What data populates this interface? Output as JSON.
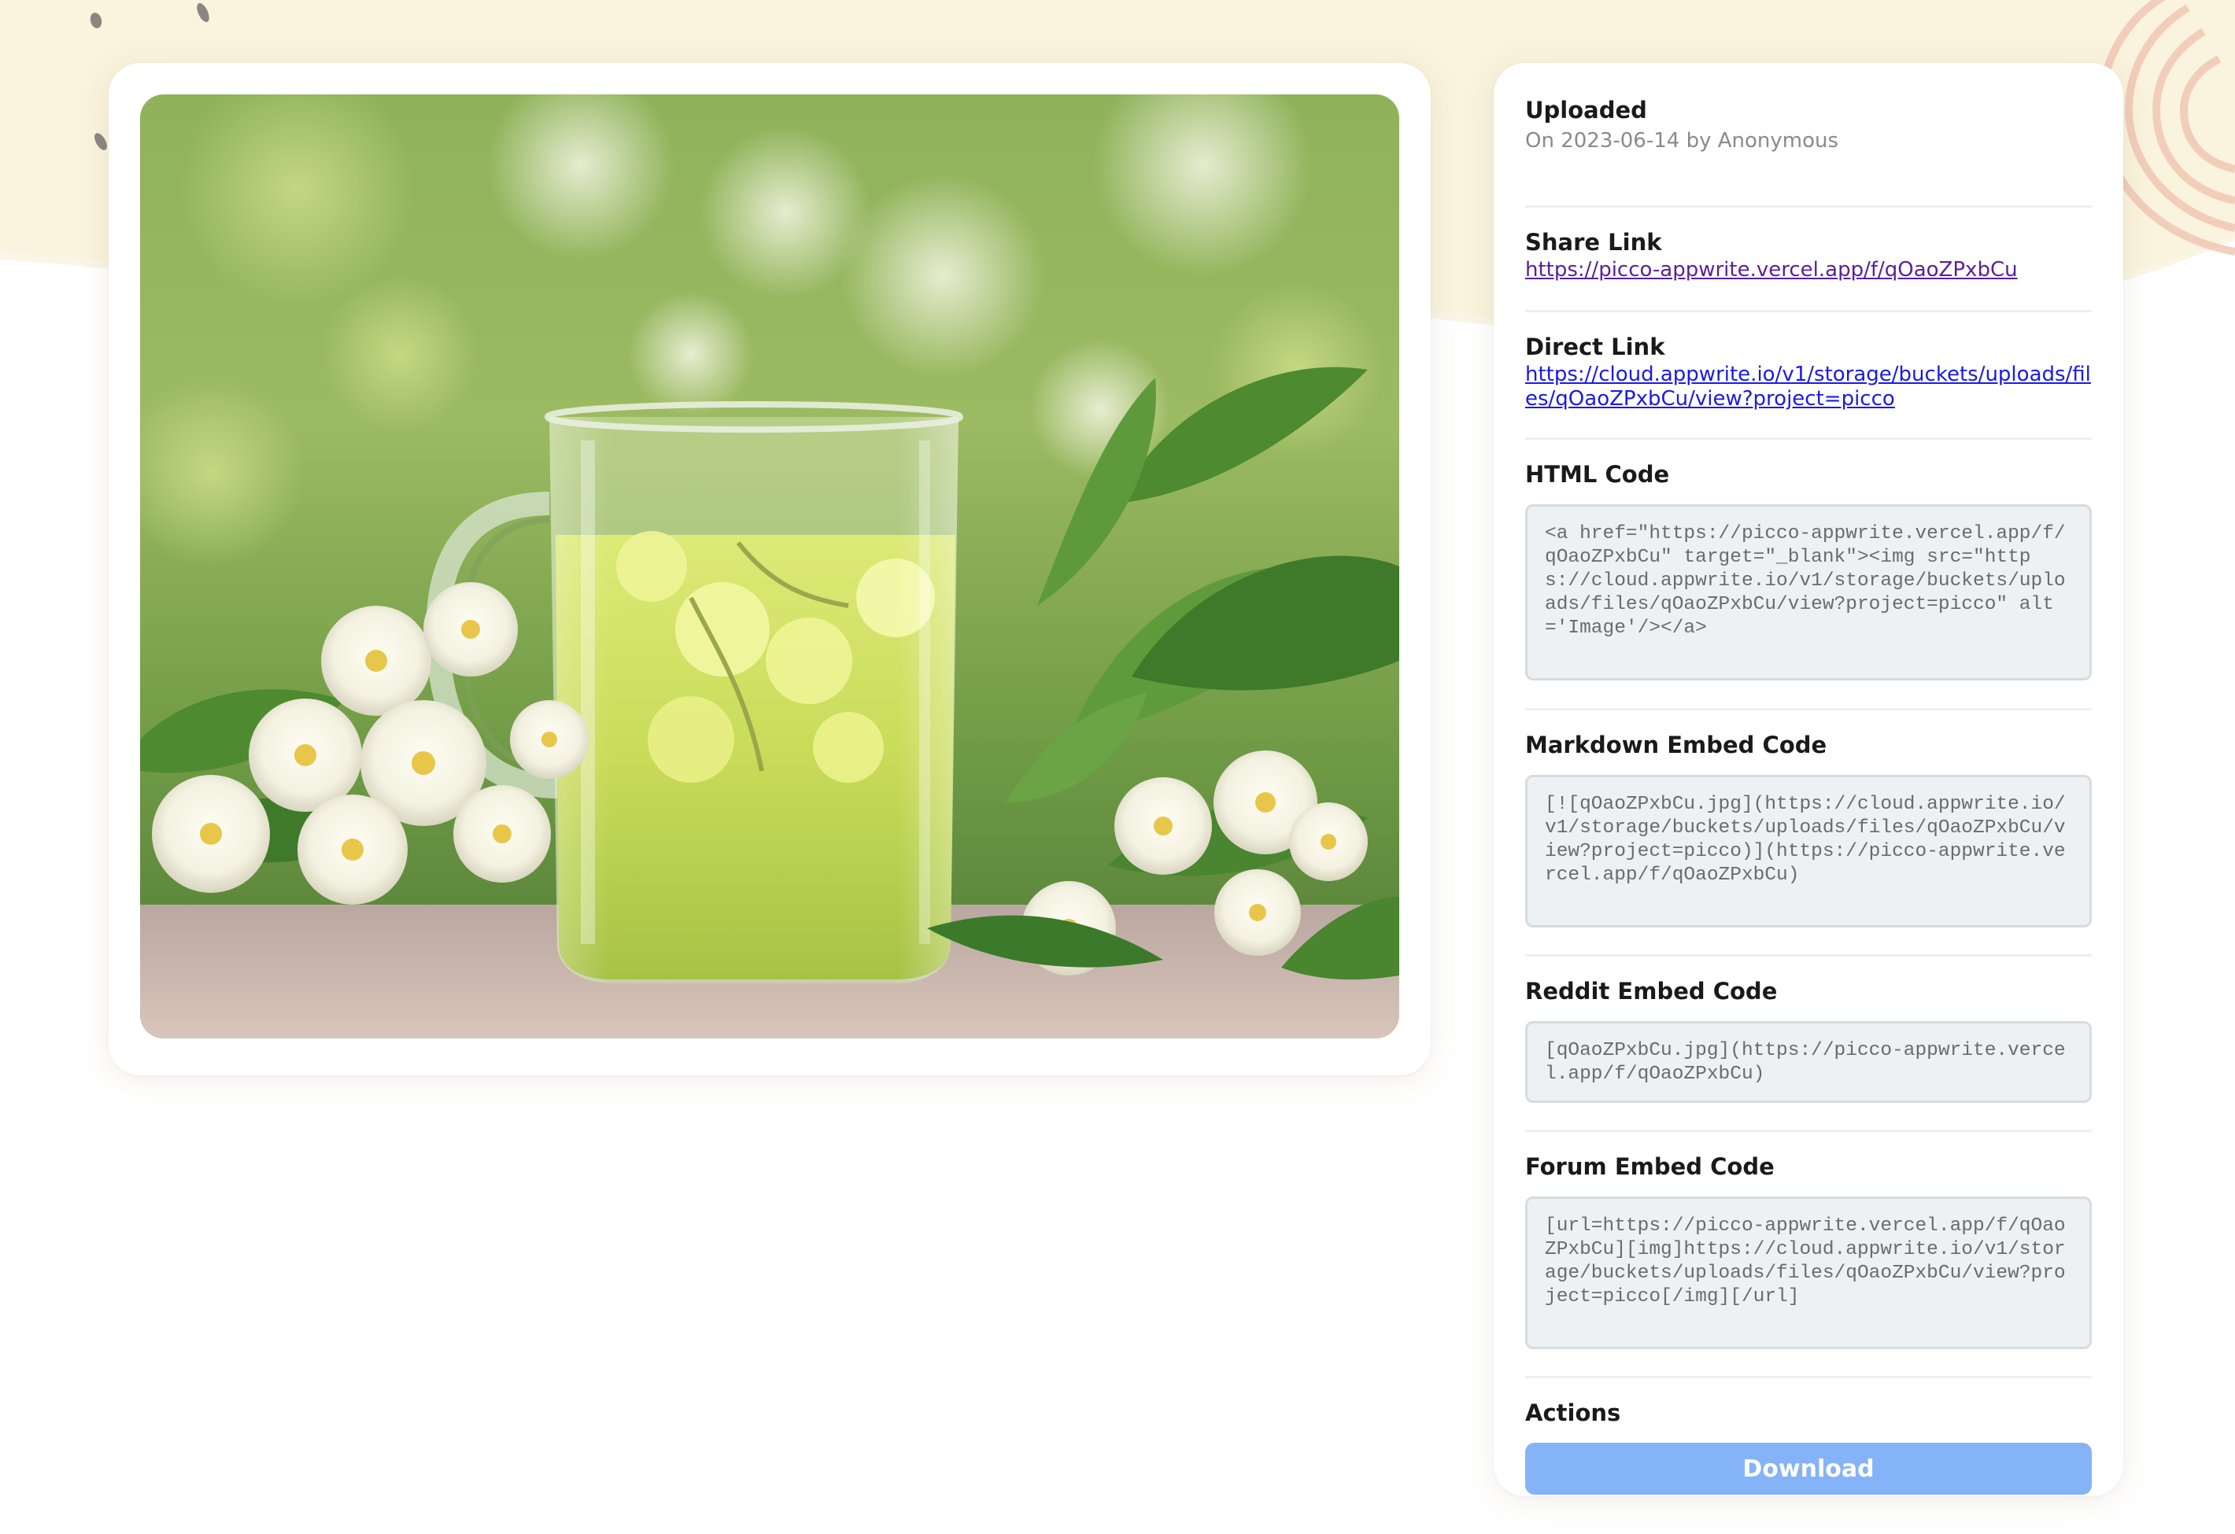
{
  "uploaded": {
    "label": "Uploaded",
    "detail": "On 2023-06-14 by Anonymous"
  },
  "share_link": {
    "label": "Share Link",
    "url": "https://picco-appwrite.vercel.app/f/qOaoZPxbCu"
  },
  "direct_link": {
    "label": "Direct Link",
    "url": "https://cloud.appwrite.io/v1/storage/buckets/uploads/files/qOaoZPxbCu/view?project=picco"
  },
  "html_code": {
    "label": "HTML Code",
    "code": "<a href=\"https://picco-appwrite.vercel.app/f/qOaoZPxbCu\" target=\"_blank\"><img src=\"https://cloud.appwrite.io/v1/storage/buckets/uploads/files/qOaoZPxbCu/view?project=picco\" alt='Image'/></a>"
  },
  "markdown_code": {
    "label": "Markdown Embed Code",
    "code": "[![qOaoZPxbCu.jpg](https://cloud.appwrite.io/v1/storage/buckets/uploads/files/qOaoZPxbCu/view?project=picco)](https://picco-appwrite.vercel.app/f/qOaoZPxbCu)"
  },
  "reddit_code": {
    "label": "Reddit Embed Code",
    "code": "[qOaoZPxbCu.jpg](https://picco-appwrite.vercel.app/f/qOaoZPxbCu)"
  },
  "forum_code": {
    "label": "Forum Embed Code",
    "code": "[url=https://picco-appwrite.vercel.app/f/qOaoZPxbCu][img]https://cloud.appwrite.io/v1/storage/buckets/uploads/files/qOaoZPxbCu/view?project=picco[/img][/url]"
  },
  "actions": {
    "label": "Actions",
    "download_label": "Download"
  },
  "image": {
    "alt": "Glass cup of green jasmine tea with white jasmine flowers and leaves"
  },
  "colors": {
    "background_cream": "#faf3dd",
    "visited_link": "#5a1f9c",
    "link": "#1a1ae8",
    "download_button": "#85b3f7"
  }
}
